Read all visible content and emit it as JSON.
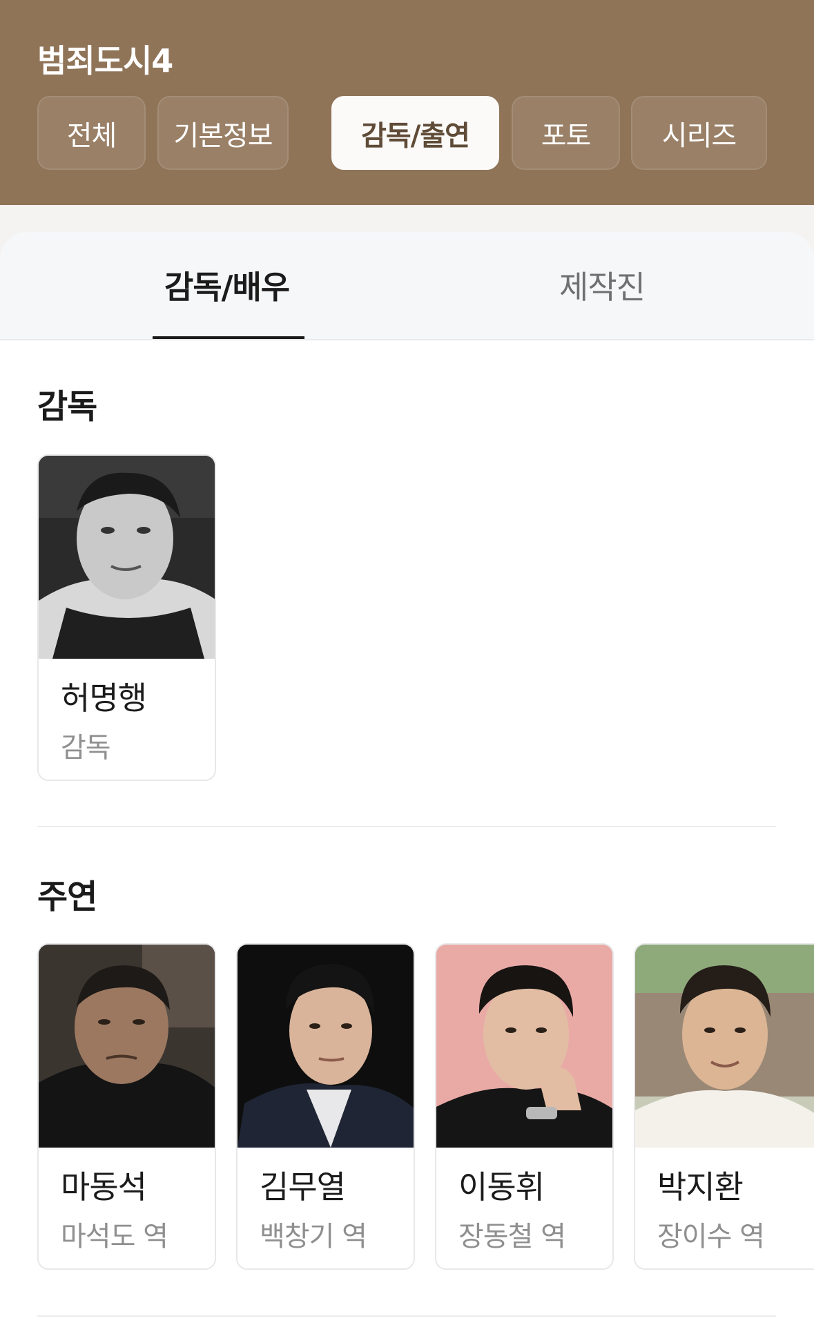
{
  "header": {
    "title": "범죄도시4",
    "tabs": [
      {
        "label": "전체",
        "active": false
      },
      {
        "label": "기본정보",
        "active": false
      },
      {
        "label": "감독/출연",
        "active": true
      },
      {
        "label": "포토",
        "active": false
      },
      {
        "label": "시리즈",
        "active": false
      }
    ]
  },
  "subtabs": [
    {
      "label": "감독/배우",
      "active": true
    },
    {
      "label": "제작진",
      "active": false
    }
  ],
  "sections": {
    "director": {
      "title": "감독",
      "people": [
        {
          "name": "허명행",
          "role": "감독"
        }
      ]
    },
    "lead": {
      "title": "주연",
      "people": [
        {
          "name": "마동석",
          "role": "마석도 역"
        },
        {
          "name": "김무열",
          "role": "백창기 역"
        },
        {
          "name": "이동휘",
          "role": "장동철 역"
        },
        {
          "name": "박지환",
          "role": "장이수 역"
        }
      ]
    }
  },
  "colors": {
    "header_bg": "#8f7458",
    "active_tab_text": "#5f4b37"
  }
}
